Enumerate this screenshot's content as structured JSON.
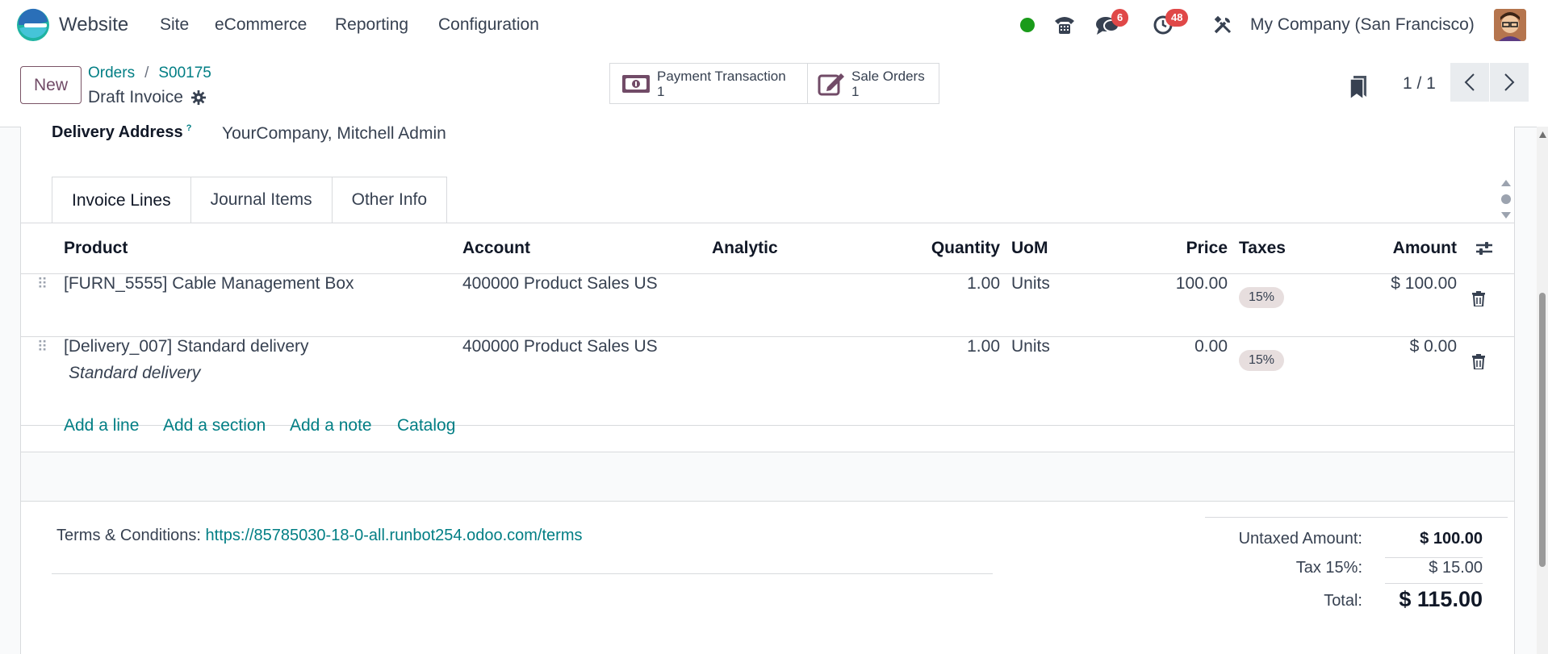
{
  "navbar": {
    "app_name": "Website",
    "menu": [
      "Site",
      "eCommerce",
      "Reporting",
      "Configuration"
    ],
    "messages_badge": "6",
    "activities_badge": "48",
    "company": "My Company (San Francisco)"
  },
  "control": {
    "new_label": "New",
    "breadcrumb": [
      "Orders",
      "S00175"
    ],
    "record_title": "Draft Invoice",
    "smart_buttons": [
      {
        "label": "Payment Transaction",
        "count": "1",
        "icon": "money-icon"
      },
      {
        "label": "Sale Orders",
        "count": "1",
        "icon": "edit-icon"
      }
    ],
    "pager": "1 / 1"
  },
  "form": {
    "delivery_label": "Delivery Address",
    "delivery_help": "?",
    "delivery_value": "YourCompany, Mitchell Admin",
    "tabs": [
      "Invoice Lines",
      "Journal Items",
      "Other Info"
    ],
    "columns": [
      "Product",
      "Account",
      "Analytic",
      "Quantity",
      "UoM",
      "Price",
      "Taxes",
      "Amount"
    ],
    "lines": [
      {
        "product": "[FURN_5555] Cable Management Box",
        "description": "",
        "account": "400000 Product Sales US",
        "analytic": "",
        "quantity": "1.00",
        "uom": "Units",
        "price": "100.00",
        "tax": "15%",
        "amount": "$ 100.00"
      },
      {
        "product": "[Delivery_007] Standard delivery",
        "description": "Standard delivery",
        "account": "400000 Product Sales US",
        "analytic": "",
        "quantity": "1.00",
        "uom": "Units",
        "price": "0.00",
        "tax": "15%",
        "amount": "$ 0.00"
      }
    ],
    "add_links": [
      "Add a line",
      "Add a section",
      "Add a note",
      "Catalog"
    ],
    "terms_label": "Terms & Conditions:",
    "terms_url": "https://85785030-18-0-all.runbot254.odoo.com/terms",
    "totals": {
      "untaxed_label": "Untaxed Amount:",
      "untaxed_value": "$ 100.00",
      "tax_label": "Tax 15%:",
      "tax_value": "$ 15.00",
      "total_label": "Total:",
      "total_value": "$ 115.00"
    }
  },
  "colors": {
    "brand": "#714b67",
    "link": "#017e84",
    "badge": "#e04848",
    "online": "#1a9b1a"
  }
}
